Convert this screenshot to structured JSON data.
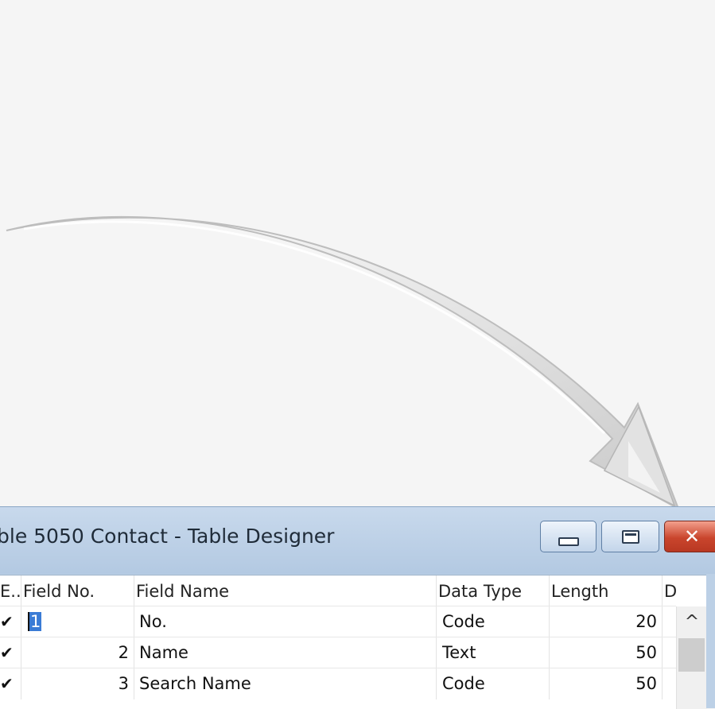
{
  "window": {
    "title": "ble 5050 Contact - Table Designer",
    "minimize_icon": "minimize-icon",
    "maximize_icon": "restore-icon",
    "close_icon": "close-icon",
    "close_glyph": "✕"
  },
  "grid": {
    "columns": [
      "E..",
      "Field No.",
      "Field Name",
      "Data Type",
      "Length",
      "D"
    ],
    "rows": [
      {
        "enabled": "✔",
        "field_no": "1",
        "field_name": "No.",
        "data_type": "Code",
        "length": "20"
      },
      {
        "enabled": "✔",
        "field_no": "2",
        "field_name": "Name",
        "data_type": "Text",
        "length": "50"
      },
      {
        "enabled": "✔",
        "field_no": "3",
        "field_name": "Search Name",
        "data_type": "Code",
        "length": "50"
      }
    ],
    "scroll_up_glyph": "^"
  },
  "colors": {
    "page_background": "#f5f5f5",
    "title_bar": "#bcd0e6",
    "close_button": "#c9452d",
    "selection": "#3a7bd5"
  }
}
